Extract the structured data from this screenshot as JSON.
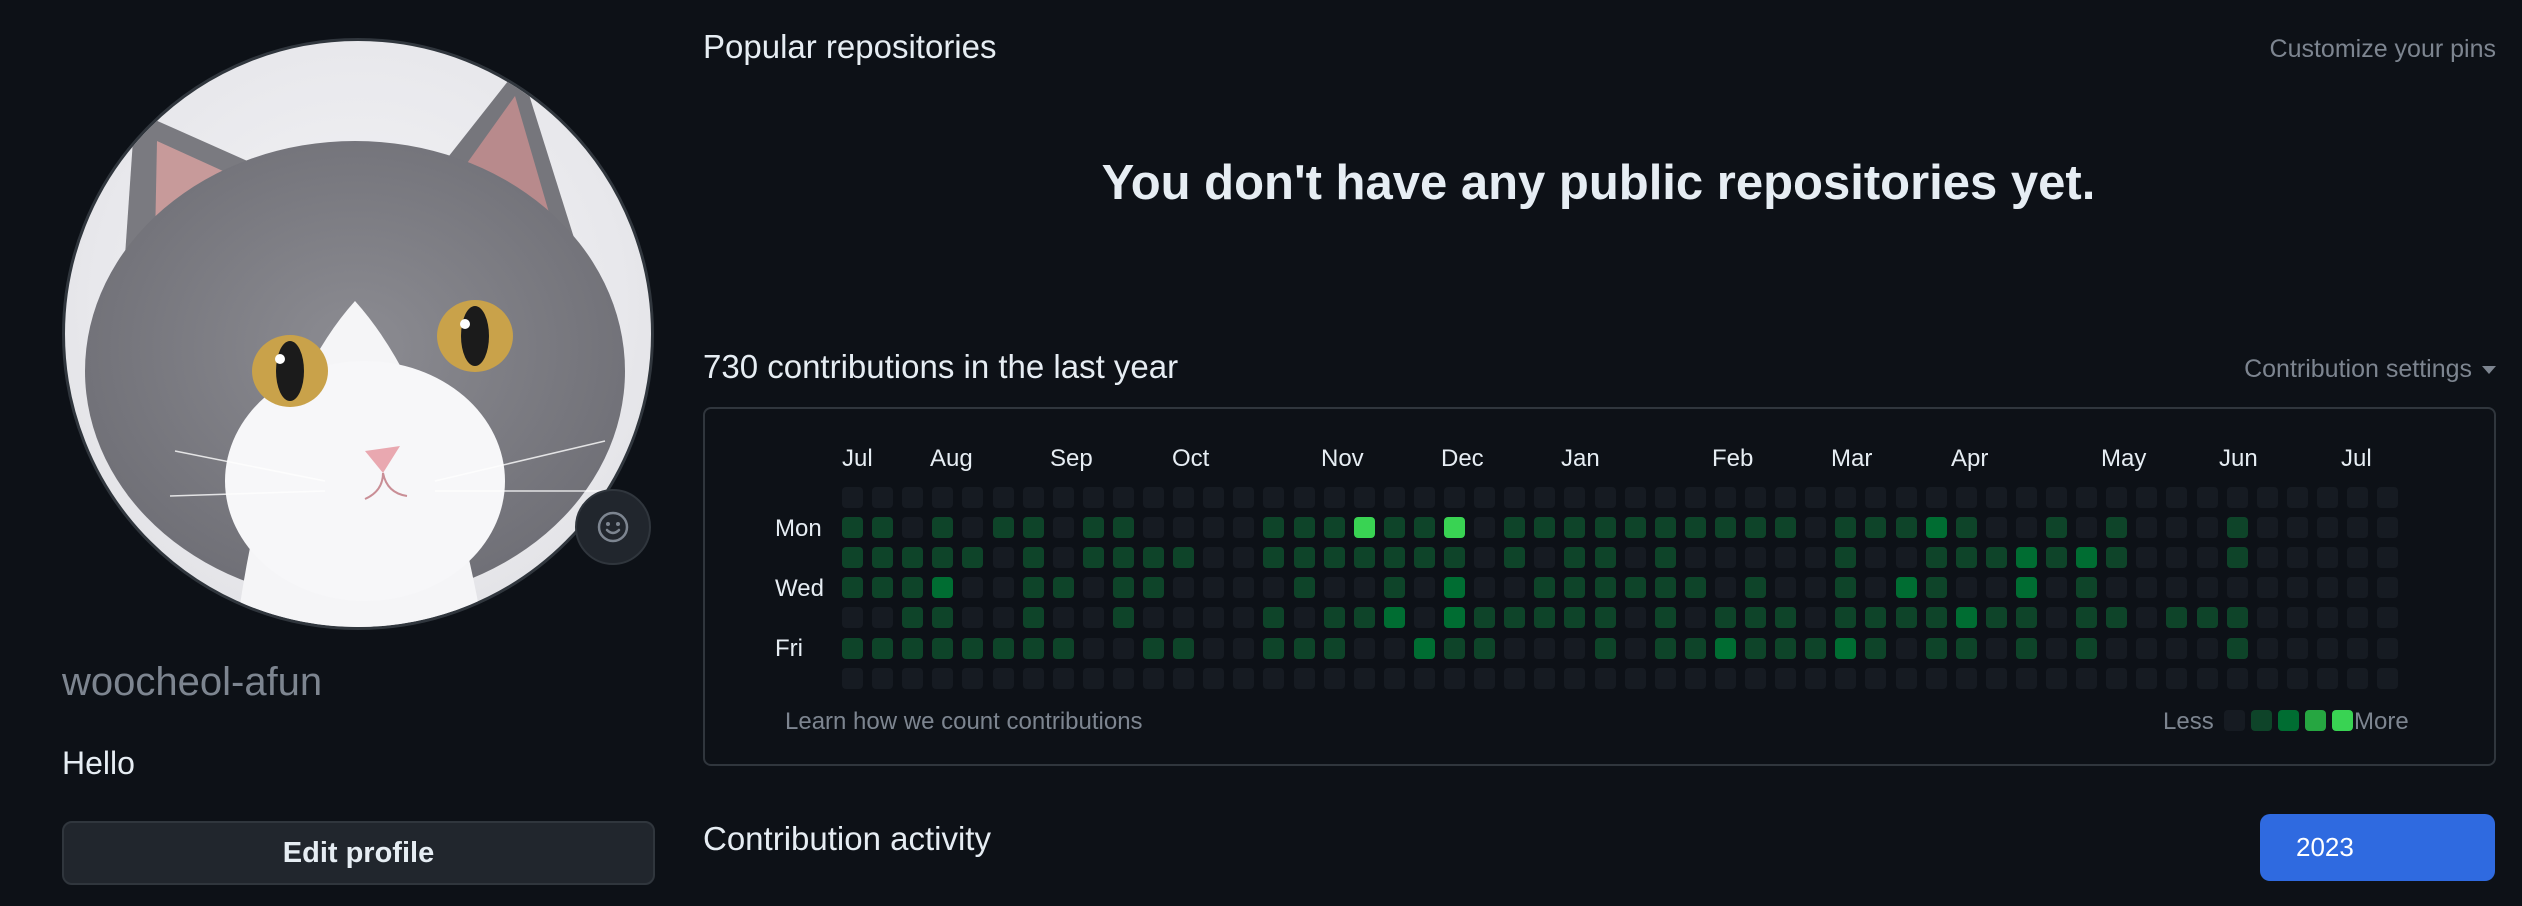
{
  "profile": {
    "username": "woocheol-afun",
    "bio": "Hello",
    "edit_label": "Edit profile"
  },
  "popular": {
    "title": "Popular repositories",
    "customize_label": "Customize your pins",
    "empty_message": "You don't have any public repositories yet."
  },
  "contributions": {
    "heading": "730 contributions in the last year",
    "settings_label": "Contribution settings",
    "months": [
      "Jul",
      "Aug",
      "Sep",
      "Oct",
      "Nov",
      "Dec",
      "Jan",
      "Feb",
      "Mar",
      "Apr",
      "May",
      "Jun",
      "Jul"
    ],
    "days": [
      "Mon",
      "Wed",
      "Fri"
    ],
    "learn_label": "Learn how we count contributions",
    "less_label": "Less",
    "more_label": "More",
    "levels": [
      "0000000000000000000000000000000000000000000000000000",
      "1101011011000011141140111111111101112100101000100000",
      "1111101011110011111110101101000001001112121000100000",
      "1112001101100001001020011111101001021002010000000000",
      "0011001001000010112021111101011101111211011011100000",
      "1111111100110011100211000101121112101101010000100000",
      "0000000000000000000000000000000000000000000000000000"
    ],
    "colors": [
      "#161b22",
      "#0e4429",
      "#006d32",
      "#26a641",
      "#39d353"
    ]
  },
  "activity": {
    "title": "Contribution activity",
    "year_label": "2023"
  }
}
